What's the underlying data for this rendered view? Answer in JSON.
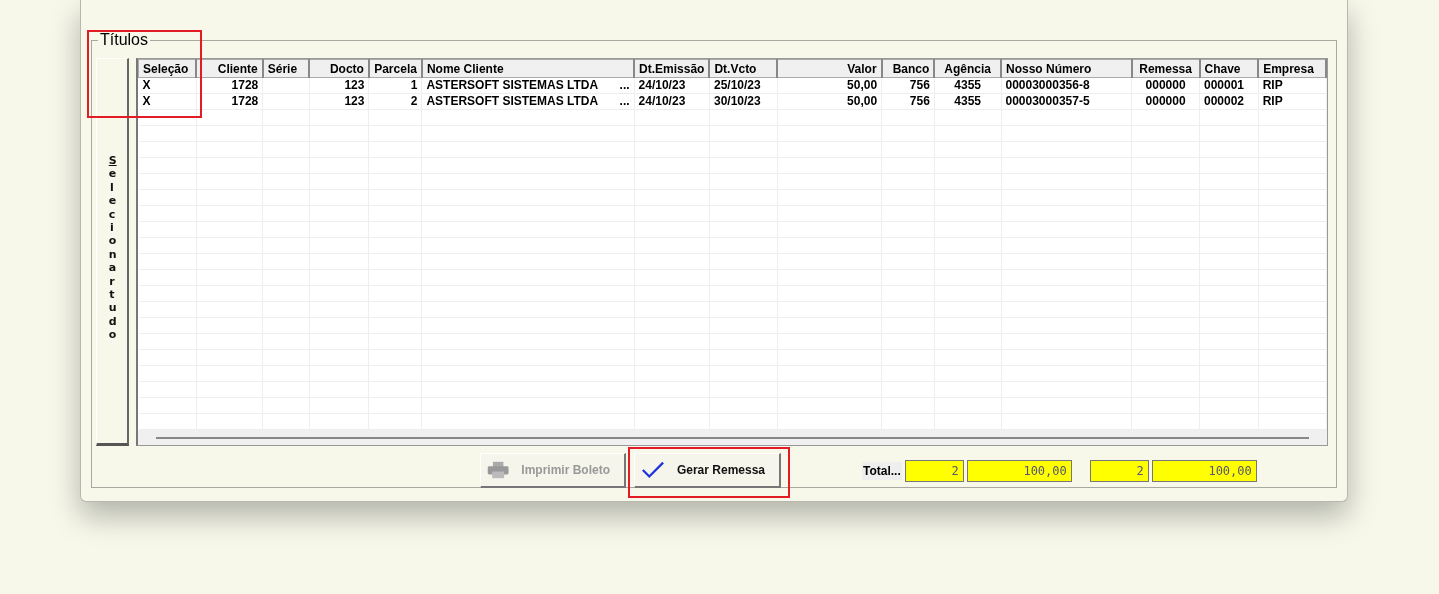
{
  "group": {
    "title": "Títulos"
  },
  "select_all_button": {
    "label": "Selecionar tudo"
  },
  "table": {
    "columns": [
      {
        "label": "Seleção",
        "highlighted": true
      },
      {
        "label": "Cliente",
        "highlighted": false
      },
      {
        "label": "Série",
        "highlighted": false
      },
      {
        "label": "Docto",
        "highlighted": false
      },
      {
        "label": "Parcela",
        "highlighted": false
      },
      {
        "label": "Nome Cliente",
        "highlighted": false
      },
      {
        "label": "Dt.Emissão",
        "highlighted": false
      },
      {
        "label": "Dt.Vcto",
        "highlighted": false
      },
      {
        "label": "Valor",
        "highlighted": false
      },
      {
        "label": "Banco",
        "highlighted": false
      },
      {
        "label": "Agência",
        "highlighted": false
      },
      {
        "label": "Nosso Número",
        "highlighted": false
      },
      {
        "label": "Remessa",
        "highlighted": false
      },
      {
        "label": "Chave",
        "highlighted": false
      },
      {
        "label": "Empresa",
        "highlighted": false
      }
    ],
    "rows": [
      {
        "cells": [
          "X",
          "1728",
          "",
          "123",
          "1",
          "ASTERSOFT SISTEMAS LTDA",
          "24/10/23",
          "25/10/23",
          "50,00",
          "756",
          "4355",
          "00003000356-8",
          "000000",
          "000001",
          "RIP"
        ],
        "lookup_button": "..."
      },
      {
        "cells": [
          "X",
          "1728",
          "",
          "123",
          "2",
          "ASTERSOFT SISTEMAS LTDA",
          "24/10/23",
          "30/10/23",
          "50,00",
          "756",
          "4355",
          "00003000357-5",
          "000000",
          "000002",
          "RIP"
        ],
        "lookup_button": "..."
      }
    ]
  },
  "buttons": [
    {
      "label": "Imprimir Boleto",
      "kind": "print",
      "disabled": true,
      "highlighted": false
    },
    {
      "label": "Gerar Remessa",
      "kind": "confirm",
      "disabled": false,
      "highlighted": true
    }
  ],
  "totals": {
    "label": "Total...",
    "fields": [
      "2",
      "100,00",
      "2",
      "100,00"
    ]
  }
}
